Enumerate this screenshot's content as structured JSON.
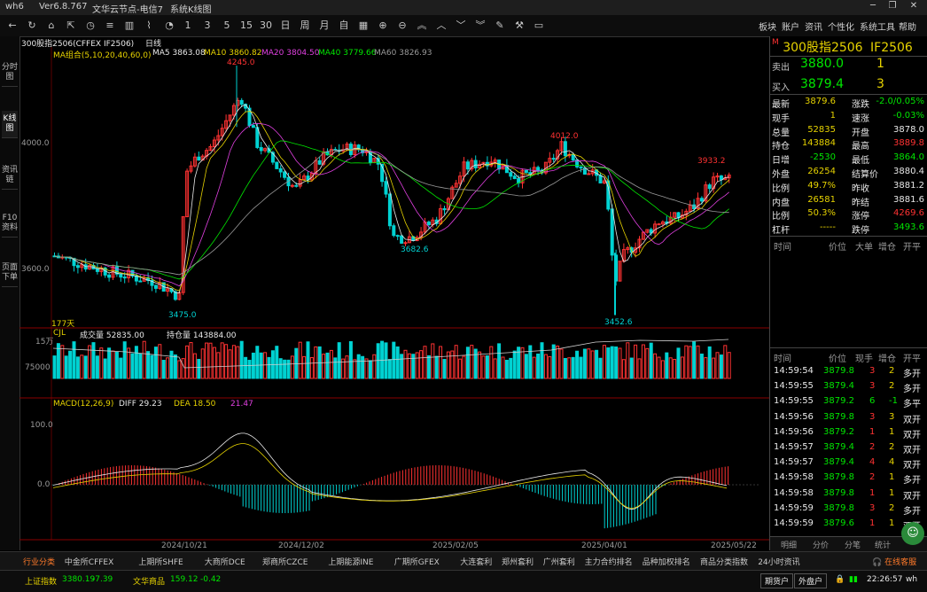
{
  "titlebar": {
    "app": "wh6",
    "version": "Ver6.8.767",
    "server": "文华云节点-电信7",
    "mode": "系统K线图"
  },
  "menu": [
    "板块",
    "账户",
    "资讯",
    "个性化",
    "系统工具",
    "帮助"
  ],
  "toolbar_digits": [
    "1",
    "3",
    "5",
    "15",
    "30",
    "日",
    "周",
    "月",
    "自"
  ],
  "left_tabs": [
    "分时图",
    "K线图",
    "资讯链",
    "F10资料",
    "页面下单"
  ],
  "chart": {
    "contract": "300股指2506(CFFEX IF2506)",
    "period": "日线",
    "ma_label": "MA组合(5,10,20,40,60,0)",
    "ma": [
      {
        "name": "MA5",
        "value": "3863.08",
        "color": "#e8e8e8"
      },
      {
        "name": "MA10",
        "value": "3860.82",
        "color": "#e6d200"
      },
      {
        "name": "MA20",
        "value": "3804.50",
        "color": "#e040e0"
      },
      {
        "name": "MA40",
        "value": "3779.66",
        "color": "#00e600"
      },
      {
        "name": "MA60",
        "value": "3826.93",
        "color": "#9a9a9a"
      }
    ],
    "y_ticks": [
      "4000.0",
      "3600.0"
    ],
    "annotations": {
      "high1": "4245.0",
      "high2": "4012.0",
      "high3": "3933.2",
      "low1": "3475.0",
      "low2": "3682.6",
      "low3": "3452.6"
    },
    "bars_count": "177天",
    "volume_label": "CJL",
    "volume_text": "成交量 52835.00",
    "oi_text": "持仓量 143884.00",
    "vol_ticks": [
      "15万",
      "75000"
    ],
    "macd_label": "MACD(12,26,9)",
    "diff": "DIFF 29.23",
    "dea": "DEA 18.50",
    "macd_val": "21.47",
    "macd_ticks": [
      "100.0",
      "0.0"
    ],
    "dates": [
      "2024/10/21",
      "2024/12/02",
      "2025/02/05",
      "2025/04/01",
      "2025/05/22"
    ]
  },
  "quote": {
    "name": "300股指2506",
    "code": "IF2506",
    "sell_label": "卖出",
    "sell_price": "3880.0",
    "sell_qty": "1",
    "buy_label": "买入",
    "buy_price": "3879.4",
    "buy_qty": "3",
    "rows": [
      [
        "最新",
        "3879.6",
        "涨跌",
        "-2.0/0.05%"
      ],
      [
        "现手",
        "1",
        "速涨",
        "-0.03%"
      ],
      [
        "总量",
        "52835",
        "开盘",
        "3878.0"
      ],
      [
        "持仓",
        "143884",
        "最高",
        "3889.8"
      ],
      [
        "日增",
        "-2530",
        "最低",
        "3864.0"
      ],
      [
        "外盘",
        "26254",
        "结算价",
        "3880.4"
      ],
      [
        "比例",
        "49.7%",
        "昨收",
        "3881.2"
      ],
      [
        "内盘",
        "26581",
        "昨结",
        "3881.6"
      ],
      [
        "比例",
        "50.3%",
        "涨停",
        "4269.6"
      ],
      [
        "杠杆",
        "-----",
        "跌停",
        "3493.6"
      ]
    ],
    "tick_header": [
      "时间",
      "价位",
      "大单",
      "增仓",
      "开平"
    ],
    "tick_header2": [
      "时间",
      "价位",
      "现手",
      "增仓",
      "开平"
    ],
    "ticks": [
      [
        "14:59:54",
        "3879.8",
        "3",
        "2",
        "多开"
      ],
      [
        "14:59:55",
        "3879.4",
        "3",
        "2",
        "多开"
      ],
      [
        "14:59:55",
        "3879.2",
        "6",
        "-1",
        "多平"
      ],
      [
        "14:59:56",
        "3879.8",
        "3",
        "3",
        "双开"
      ],
      [
        "14:59:56",
        "3879.2",
        "1",
        "1",
        "双开"
      ],
      [
        "14:59:57",
        "3879.4",
        "2",
        "2",
        "双开"
      ],
      [
        "14:59:57",
        "3879.4",
        "4",
        "4",
        "双开"
      ],
      [
        "14:59:58",
        "3879.8",
        "2",
        "1",
        "多开"
      ],
      [
        "14:59:58",
        "3879.8",
        "1",
        "1",
        "双开"
      ],
      [
        "14:59:59",
        "3879.8",
        "3",
        "2",
        "多开"
      ],
      [
        "14:59:59",
        "3879.6",
        "1",
        "1",
        "双开"
      ]
    ],
    "tabs": [
      "明细",
      "分价",
      "分笔",
      "统计"
    ]
  },
  "bottom_tabs": [
    "行业分类",
    "中金所CFFEX",
    "上期所SHFE",
    "大商所DCE",
    "郑商所CZCE",
    "上期能源INE",
    "广期所GFEX",
    "大连套利",
    "郑州套利",
    "广州套利",
    "主力合约排名",
    "品种加权排名",
    "商品分类指数",
    "24小时资讯"
  ],
  "service": "在线客服",
  "status": {
    "idx1_name": "上证指数",
    "idx1_val": "3380.19",
    "idx1_chg": "-7.39",
    "idx2_name": "文华商品",
    "idx2_val": "159.12",
    "idx2_chg": "-0.42",
    "btn1": "期货户",
    "btn2": "外盘户",
    "time": "22:26:57",
    "user": "wh"
  }
}
